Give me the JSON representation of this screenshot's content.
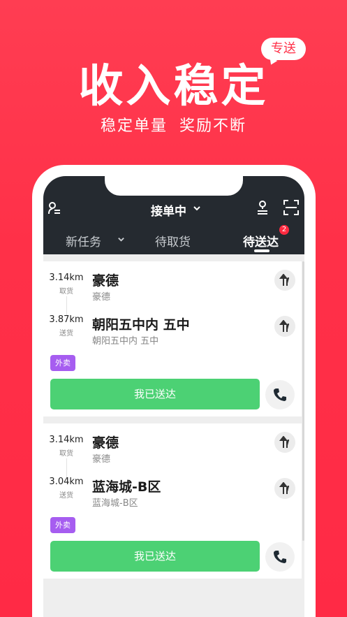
{
  "hero": {
    "title": "收入稳定",
    "badge": "专送",
    "subtitle": "稳定单量  奖励不断"
  },
  "app": {
    "status_title": "接单中",
    "tabs": [
      {
        "label": "新任务",
        "active": false
      },
      {
        "label": "待取货",
        "active": false
      },
      {
        "label": "待送达",
        "active": true,
        "badge": "2"
      }
    ],
    "icons": {
      "left": "rider-list-icon",
      "route": "route-icon",
      "scan": "scan-icon"
    }
  },
  "orders": [
    {
      "pickup": {
        "distance": "3.14km",
        "type": "取货",
        "name": "豪德",
        "address": "豪德"
      },
      "dropoff": {
        "distance": "3.87km",
        "type": "送货",
        "name": "朝阳五中内 五中",
        "address": "朝阳五中内 五中"
      },
      "tag": "外卖",
      "action": "我已送达"
    },
    {
      "pickup": {
        "distance": "3.14km",
        "type": "取货",
        "name": "豪德",
        "address": "豪德"
      },
      "dropoff": {
        "distance": "3.04km",
        "type": "送货",
        "name": "蓝海城-B区",
        "address": "蓝海城-B区"
      },
      "tag": "外卖",
      "action": "我已送达"
    }
  ],
  "colors": {
    "brand_red": "#ff3048",
    "topbar": "#252a30",
    "deliver_green": "#4cd174",
    "tag_purple": "#a65df0"
  }
}
